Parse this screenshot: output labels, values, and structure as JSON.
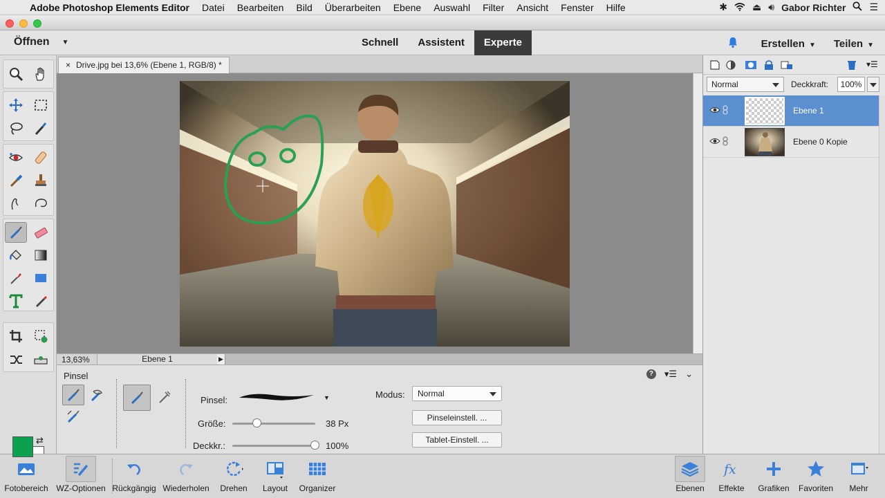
{
  "menubar": {
    "app": "Adobe Photoshop Elements Editor",
    "items": [
      "Datei",
      "Bearbeiten",
      "Bild",
      "Überarbeiten",
      "Ebene",
      "Auswahl",
      "Filter",
      "Ansicht",
      "Fenster",
      "Hilfe"
    ],
    "user": "Gabor Richter"
  },
  "topbar": {
    "open_label": "Öffnen",
    "modes": [
      "Schnell",
      "Assistent",
      "Experte"
    ],
    "create_label": "Erstellen",
    "share_label": "Teilen"
  },
  "document": {
    "tab_close": "×",
    "tab_title": "Drive.jpg bei 13,6% (Ebene 1, RGB/8) *"
  },
  "statusbar": {
    "zoom": "13,63%",
    "layer": "Ebene 1"
  },
  "tool_options": {
    "title": "Pinsel",
    "brush_label": "Pinsel:",
    "size_label": "Größe:",
    "size_value": "38 Px",
    "size_fraction": 0.3,
    "opacity_label": "Deckkr.:",
    "opacity_value": "100%",
    "opacity_fraction": 1.0,
    "mode_label": "Modus:",
    "mode_value": "Normal",
    "brush_settings_button": "Pinseleinstell. ...",
    "tablet_settings_button": "Tablet-Einstell. ..."
  },
  "layers": {
    "blend_mode": "Normal",
    "opacity_label": "Deckkraft:",
    "opacity_value": "100%",
    "items": [
      {
        "name": "Ebene 1",
        "selected": true
      },
      {
        "name": "Ebene 0 Kopie",
        "selected": false
      }
    ]
  },
  "bottombar": {
    "left": [
      "Fotobereich",
      "WZ-Optionen",
      "Rückgängig",
      "Wiederholen",
      "Drehen",
      "Layout",
      "Organizer"
    ],
    "right": [
      "Ebenen",
      "Effekte",
      "Grafiken",
      "Favoriten",
      "Mehr"
    ]
  },
  "colors": {
    "foreground": "#0ba14e",
    "background": "#ffffff",
    "selection": "#5b8fd0",
    "active_mode_tab": "#3b3b3b"
  }
}
